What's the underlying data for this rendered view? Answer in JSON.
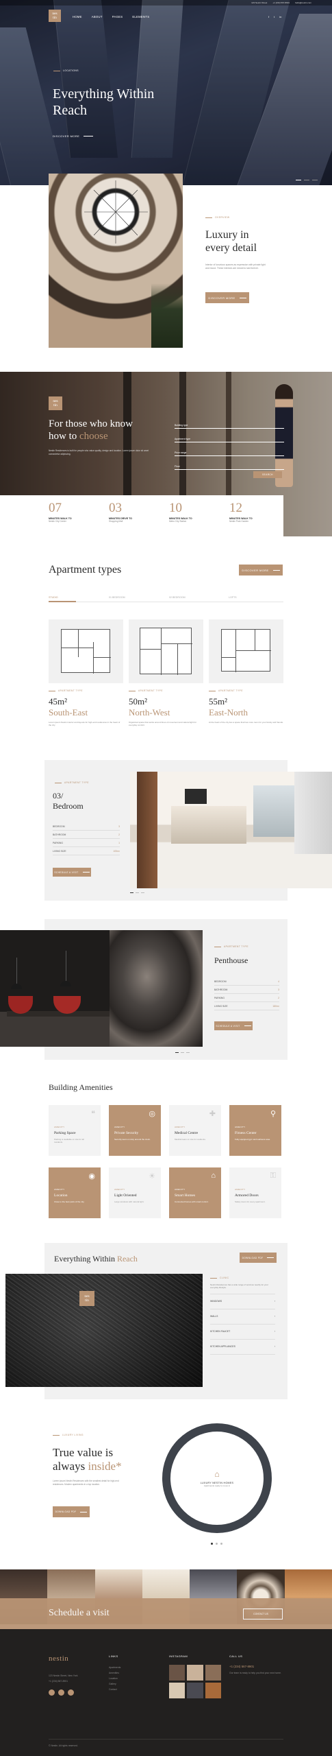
{
  "topbar": {
    "address": "123 Nestin Street",
    "phone": "+1 (234) 567-8901",
    "email": "hello@nestin.com",
    "socials": [
      "f",
      "t",
      "in"
    ]
  },
  "nav": {
    "logo": "nes\ntin",
    "items": [
      "HOME",
      "ABOUT",
      "PAGES",
      "ELEMENTS"
    ]
  },
  "hero": {
    "caption": "LOCATIONS",
    "title": "Everything Within Reach",
    "button": "DISCOVER MORE"
  },
  "luxury": {
    "caption": "OVERVIEW",
    "title": "Luxury in every detail",
    "text": "Interior of luxurious spaces as expression with private light and mood. These interiors are meant to last forever.",
    "button": "DISCOVER MORE"
  },
  "choose": {
    "logo": "nes\ntin",
    "title1": "For those who know",
    "title2": "how to",
    "title_accent": "choose",
    "text": "Nestin Residences is built for people who value quality, design and location. Lorem ipsum dolor sit amet consectetur adipiscing.",
    "form": [
      "Building type",
      "Apartment type",
      "Price range",
      "Floor"
    ],
    "form_button": "SEARCH"
  },
  "stats": [
    {
      "num": "07",
      "label": "MINUTES WALK TO",
      "sub": "Nestin City Center"
    },
    {
      "num": "03",
      "label": "MINUTES DRIVE TO",
      "sub": "Shopping Mall"
    },
    {
      "num": "10",
      "label": "MINUTES WALK TO",
      "sub": "Metro City Station"
    },
    {
      "num": "12",
      "label": "MINUTES WALK TO",
      "sub": "Nestin Park Garden"
    }
  ],
  "apartments": {
    "title": "Apartment types",
    "button": "DISCOVER MORE",
    "tabs": [
      "STUDIO",
      "01 BEDROOM",
      "02 BEDROOM",
      "LOFTS"
    ],
    "cards": [
      {
        "cap": "APARTMENT TYPE",
        "size": "45m²",
        "sup": "2",
        "dir": "South-East",
        "text": "Lorem ipsum Nestin interior and layouts for high-end residences in the heart of the city."
      },
      {
        "cap": "APARTMENT TYPE",
        "size": "50m²",
        "sup": "2",
        "dir": "North-West",
        "text": "Organized space that works around lines of movement and natural light for everyday comfort."
      },
      {
        "cap": "APARTMENT TYPE",
        "size": "55m²",
        "sup": "2",
        "dir": "East-North",
        "text": "At the heart of the city lies a space that has more room for your family and friends."
      }
    ]
  },
  "bedroom": {
    "cap": "APARTMENT TYPE",
    "title": "03/ Bedroom",
    "rows": [
      [
        "BEDROOM",
        "3"
      ],
      [
        "BATHROOM",
        "2"
      ],
      [
        "PARKING",
        "1"
      ],
      [
        "LIVING SIZE",
        "105m²"
      ]
    ],
    "button": "SCHEDULE A VISIT"
  },
  "penthouse": {
    "cap": "APARTMENT TYPE",
    "title": "Penthouse",
    "rows": [
      [
        "BEDROOM",
        "4"
      ],
      [
        "BATHROOM",
        "3"
      ],
      [
        "PARKING",
        "2"
      ],
      [
        "LIVING SIZE",
        "180m²"
      ]
    ],
    "button": "SCHEDULE A VISIT"
  },
  "amenities": {
    "title": "Building Amenities",
    "items": [
      {
        "cap": "AMENITY",
        "title": "Parking Space",
        "text": "Parking is available on site for all residents.",
        "style": "w",
        "icon": "❝"
      },
      {
        "cap": "AMENITY",
        "title": "Private Security",
        "text": "Security team on duty around the clock.",
        "style": "b",
        "icon": "◎"
      },
      {
        "cap": "AMENITY",
        "title": "Medical Centre",
        "text": "Medical team on site for residents.",
        "style": "w",
        "icon": "✚"
      },
      {
        "cap": "AMENITY",
        "title": "Fitness Center",
        "text": "Fully equipped gym and wellness area.",
        "style": "b",
        "icon": "⚲"
      },
      {
        "cap": "AMENITY",
        "title": "Location",
        "text": "Close to the best parts of the city.",
        "style": "b",
        "icon": "◉"
      },
      {
        "cap": "AMENITY",
        "title": "Light Oriented",
        "text": "Large windows with natural light.",
        "style": "w",
        "icon": "☀"
      },
      {
        "cap": "AMENITY",
        "title": "Smart Homes",
        "text": "Connected homes with smart control.",
        "style": "b",
        "icon": "⌂"
      },
      {
        "cap": "AMENITY",
        "title": "Armored Doors",
        "text": "Safety doors for every apartment.",
        "style": "w",
        "icon": "⚿"
      }
    ]
  },
  "reach": {
    "title": "Everything Within",
    "accent": "Reach",
    "button": "DOWNLOAD PDF",
    "logo": "nes\ntin",
    "accordion_open": "CLINIC",
    "accordion_text": "Nestin Residences has a wide range of services nearby for your everyday lifestyle.",
    "accordion": [
      "WINDOWS",
      "WALLS",
      "KITCHEN FAUCET",
      "KITCHEN APPLIANCES"
    ]
  },
  "value": {
    "cap": "LUXURY LIVING",
    "title1": "True value is",
    "title2": "always",
    "accent": "inside*",
    "text": "Lorem ipsum Nestin Residences with the smallest detail for high-end residences. Modern apartments in a top location.",
    "button": "DOWNLOAD PDF",
    "circle_title": "LUXURY NESTIN HOMES",
    "circle_text": "Apartments ready to move in"
  },
  "schedule": {
    "title": "Schedule a visit",
    "button": "CONTACT US"
  },
  "footer": {
    "logo": "nestin",
    "address": "123 Nestin Street, New York",
    "phone": "+1 (234) 567-8901",
    "cols": [
      {
        "title": "LINKS",
        "items": [
          "Apartments",
          "Amenities",
          "Location",
          "Gallery",
          "Contact"
        ]
      },
      {
        "title": "INSTAGRAM"
      },
      {
        "title": "CALL US",
        "phone": "+1 (234) 567-8901",
        "text": "Our team is ready to help you find your new home."
      }
    ],
    "copyright": "© Nestin. All rights reserved."
  }
}
